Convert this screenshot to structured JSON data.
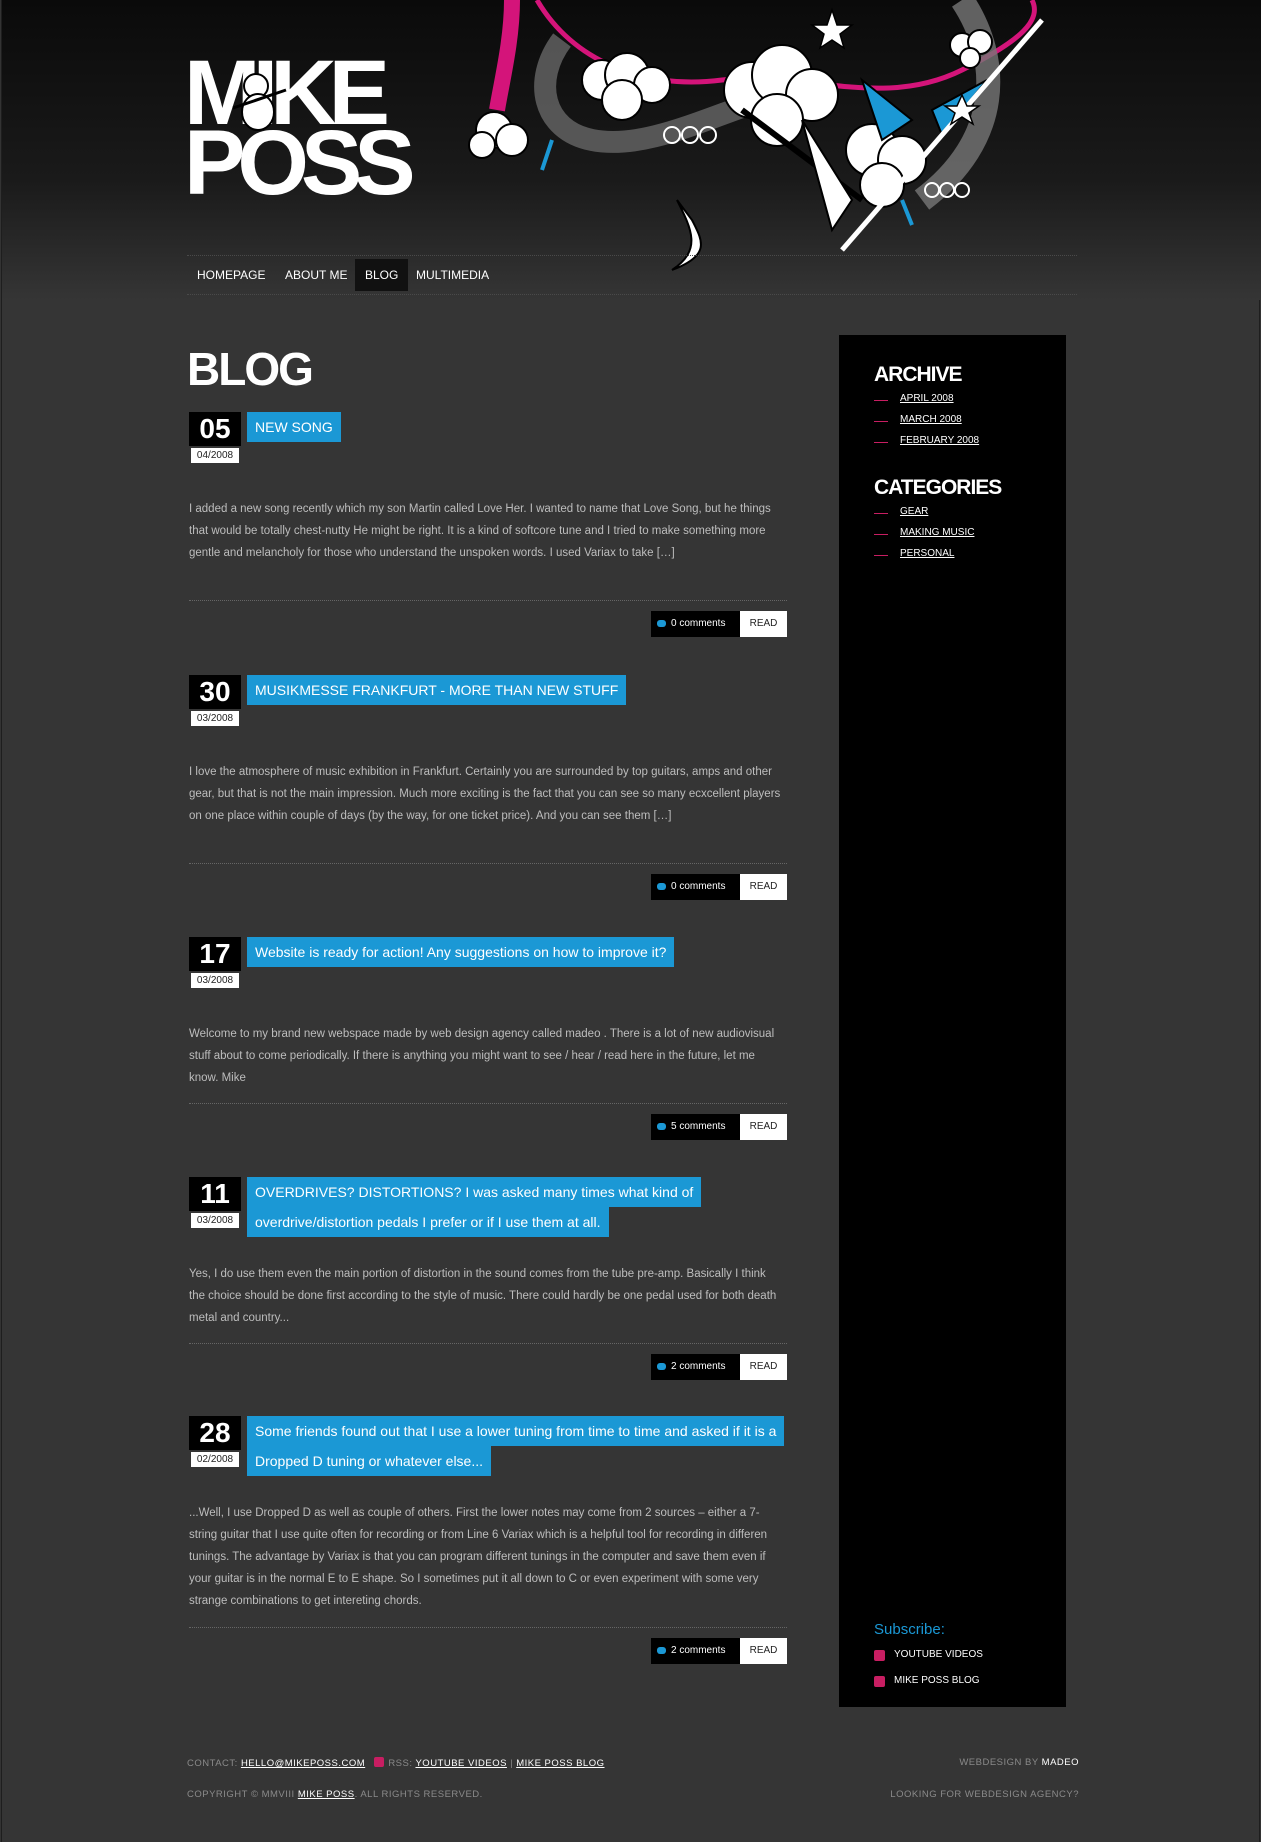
{
  "header": {
    "logo_line1": "MIKE",
    "logo_line2": "POSS"
  },
  "nav": {
    "items": [
      {
        "label": "HOMEPAGE",
        "active": false
      },
      {
        "label": "ABOUT ME",
        "active": false
      },
      {
        "label": "BLOG",
        "active": true
      },
      {
        "label": "MULTIMEDIA",
        "active": false
      }
    ]
  },
  "content": {
    "title": "BLOG"
  },
  "posts": [
    {
      "day": "05",
      "month": "04/2008",
      "title": "NEW SONG",
      "excerpt": "I added a new song recently which my son Martin called Love Her. I wanted to name that Love Song, but he things that would be totally chest-nutty He might be right. It is a kind of softcore tune and I tried to make something more gentle and melancholy for those who understand the unspoken words. I used Variax to take […]",
      "comments": "0 comments",
      "read": "READ"
    },
    {
      "day": "30",
      "month": "03/2008",
      "title": "MUSIKMESSE FRANKFURT - MORE THAN NEW STUFF",
      "excerpt": "I love the atmosphere of music exhibition in Frankfurt. Certainly you are surrounded by top guitars, amps and other gear, but that is not the main impression. Much more exciting is the fact that you can see so many ecxcellent players on one place within couple of days (by the way, for one ticket price).  And you can see them […]",
      "comments": "0 comments",
      "read": "READ"
    },
    {
      "day": "17",
      "month": "03/2008",
      "title": "Website is ready for action! Any suggestions on how to improve it?",
      "excerpt": "Welcome to my brand new webspace made by web design agency called madeo . There is a lot of new audiovisual stuff about to come periodically. If there is anything you might want to see / hear / read here in the future, let me know.  Mike",
      "comments": "5 comments",
      "read": "READ"
    },
    {
      "day": "11",
      "month": "03/2008",
      "title": "OVERDRIVES? DISTORTIONS? I was asked many times what kind of overdrive/distortion pedals I prefer or if I use them at all.",
      "excerpt": "Yes, I do use them even the main portion of distortion in the sound comes from the tube pre-amp. Basically I think the choice should be done first according to the style of music. There could hardly be one pedal used for both death metal and country...",
      "comments": "2 comments",
      "read": "READ"
    },
    {
      "day": "28",
      "month": "02/2008",
      "title": "Some friends found out that I use a lower tuning from time to time and asked if it is a Dropped D tuning or whatever else...",
      "excerpt": "...Well, I use Dropped D as well as couple of others. First the lower notes may come from 2 sources – either a 7-string guitar that I use quite often for recording or from Line 6 Variax which is a helpful tool for recording in differen tunings. The advantage by Variax is that you can program different tunings in the computer and save them even if your guitar is in the normal E to E shape. So I sometimes put it all down to C or even experiment with some very strange combinations to get intereting chords.",
      "comments": "2 comments",
      "read": "READ"
    }
  ],
  "sidebar": {
    "archive_title": "ARCHIVE",
    "archive": [
      "APRIL 2008",
      "MARCH 2008",
      "FEBRUARY 2008"
    ],
    "categories_title": "CATEGORIES",
    "categories": [
      "GEAR",
      "MAKING MUSIC",
      "PERSONAL"
    ],
    "subscribe_title": "Subscribe:",
    "subscribe": [
      "YOUTUBE VIDEOS",
      "MIKE POSS BLOG"
    ]
  },
  "footer": {
    "contact_label": "CONTACT:",
    "contact_email": "HELLO@MIKEPOSS.COM",
    "rss_label": "RSS:",
    "rss_youtube": "YOUTUBE VIDEOS",
    "rss_sep": "|",
    "rss_blog": "MIKE POSS BLOG",
    "webdesign_label": "WEBDESIGN BY",
    "webdesign_name": "MADEO",
    "copyright_prefix": "COPYRIGHT © MMVIII",
    "copyright_name": "MIKE POSS",
    "copyright_suffix": ". ALL RIGHTS RESERVED.",
    "agency_link": "LOOKING FOR WEBDESIGN AGENCY?"
  },
  "colors": {
    "accent_blue": "#1b98d5",
    "accent_pink": "#c81e62",
    "background": "#353535",
    "sidebar": "#000000"
  },
  "icons": [
    "comment-icon",
    "rss-icon",
    "cherub-icon",
    "guitar-icon",
    "cloud-icon",
    "star-icon"
  ]
}
